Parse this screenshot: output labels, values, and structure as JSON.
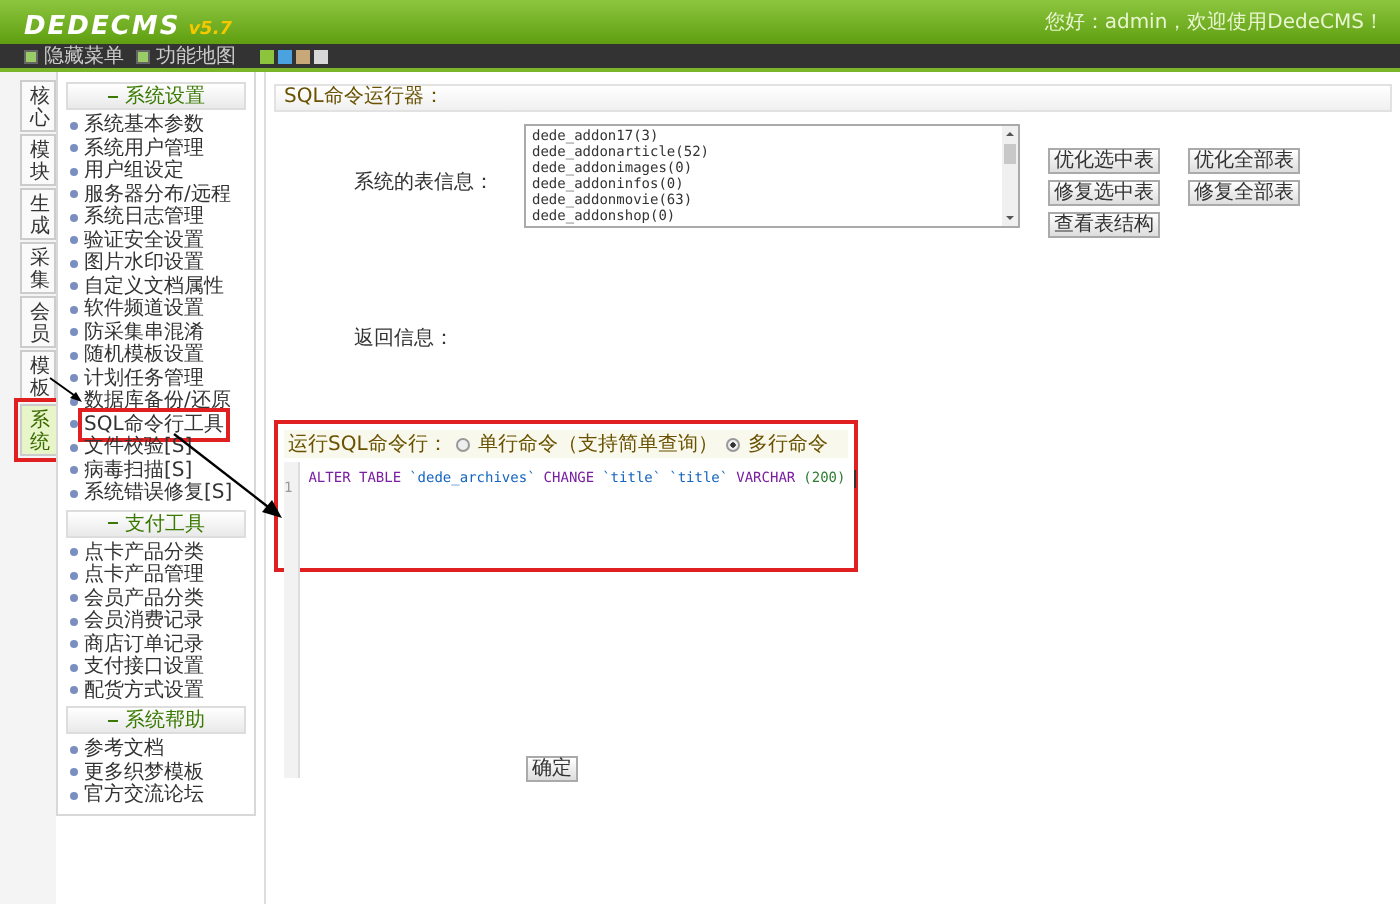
{
  "header": {
    "logo": "DEDECMS",
    "version": "v5.7",
    "greeting": "您好：admin，欢迎使用DedeCMS！"
  },
  "toolbar": {
    "items": [
      "隐藏菜单",
      "功能地图"
    ],
    "skins": [
      {
        "color": "#8dc43e"
      },
      {
        "color": "#4aa3df"
      },
      {
        "color": "#c8a878"
      },
      {
        "color": "#d8d8d8"
      }
    ]
  },
  "side_tabs": [
    {
      "label": "核心",
      "selected": false,
      "highlighted": false
    },
    {
      "label": "模块",
      "selected": false,
      "highlighted": false
    },
    {
      "label": "生成",
      "selected": false,
      "highlighted": false
    },
    {
      "label": "采集",
      "selected": false,
      "highlighted": false
    },
    {
      "label": "会员",
      "selected": false,
      "highlighted": false
    },
    {
      "label": "模板",
      "selected": false,
      "highlighted": false
    },
    {
      "label": "系统",
      "selected": true,
      "highlighted": true
    }
  ],
  "menu_groups": [
    {
      "title": "系统设置",
      "items": [
        {
          "label": "系统基本参数",
          "highlighted": false
        },
        {
          "label": "系统用户管理",
          "highlighted": false
        },
        {
          "label": "用户组设定",
          "highlighted": false
        },
        {
          "label": "服务器分布/远程",
          "highlighted": false
        },
        {
          "label": "系统日志管理",
          "highlighted": false
        },
        {
          "label": "验证安全设置",
          "highlighted": false
        },
        {
          "label": "图片水印设置",
          "highlighted": false
        },
        {
          "label": "自定义文档属性",
          "highlighted": false
        },
        {
          "label": "软件频道设置",
          "highlighted": false
        },
        {
          "label": "防采集串混淆",
          "highlighted": false
        },
        {
          "label": "随机模板设置",
          "highlighted": false
        },
        {
          "label": "计划任务管理",
          "highlighted": false
        },
        {
          "label": "数据库备份/还原",
          "highlighted": false
        },
        {
          "label": "SQL命令行工具",
          "highlighted": true
        },
        {
          "label": "文件校验[S]",
          "highlighted": false
        },
        {
          "label": "病毒扫描[S]",
          "highlighted": false
        },
        {
          "label": "系统错误修复[S]",
          "highlighted": false
        }
      ]
    },
    {
      "title": "支付工具",
      "items": [
        {
          "label": "点卡产品分类",
          "highlighted": false
        },
        {
          "label": "点卡产品管理",
          "highlighted": false
        },
        {
          "label": "会员产品分类",
          "highlighted": false
        },
        {
          "label": "会员消费记录",
          "highlighted": false
        },
        {
          "label": "商店订单记录",
          "highlighted": false
        },
        {
          "label": "支付接口设置",
          "highlighted": false
        },
        {
          "label": "配货方式设置",
          "highlighted": false
        }
      ]
    },
    {
      "title": "系统帮助",
      "items": [
        {
          "label": "参考文档",
          "highlighted": false
        },
        {
          "label": "更多织梦模板",
          "highlighted": false
        },
        {
          "label": "官方交流论坛",
          "highlighted": false
        }
      ]
    }
  ],
  "content": {
    "title": "SQL命令运行器：",
    "tables_label": "系统的表信息：",
    "tables": [
      "dede_addon17(3)",
      "dede_addonarticle(52)",
      "dede_addonimages(0)",
      "dede_addoninfos(0)",
      "dede_addonmovie(63)",
      "dede_addonshop(0)"
    ],
    "table_buttons": [
      "优化选中表",
      "优化全部表",
      "修复选中表",
      "修复全部表",
      "查看表结构"
    ],
    "result_label": "返回信息：",
    "command": {
      "label": "运行SQL命令行：",
      "highlighted": true,
      "modes": [
        {
          "label": "单行命令（支持简单查询）",
          "selected": false
        },
        {
          "label": "多行命令",
          "selected": true
        }
      ],
      "line_number": "1",
      "tokens": [
        {
          "text": "ALTER TABLE",
          "kind": "keyword"
        },
        {
          "text": "`dede_archives`",
          "kind": "name"
        },
        {
          "text": "CHANGE",
          "kind": "keyword"
        },
        {
          "text": "`title`",
          "kind": "name"
        },
        {
          "text": "`title`",
          "kind": "name"
        },
        {
          "text": "VARCHAR",
          "kind": "keyword"
        },
        {
          "text": "(200)",
          "kind": "number"
        }
      ]
    },
    "submit": "确定"
  }
}
